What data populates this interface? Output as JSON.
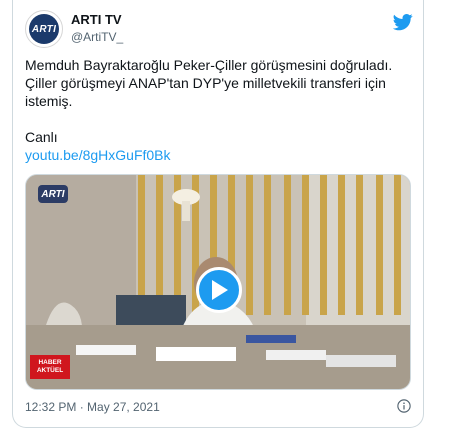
{
  "account": {
    "name": "ARTI TV",
    "handle": "@ArtiTV_",
    "avatar_text": "ARTI"
  },
  "tweet": {
    "text_line1": "Memduh Bayraktaroğlu Peker-Çiller görüşmesini doğruladı. Çiller görüşmeyi ANAP'tan DYP'ye milletvekili transferi için istemiş.",
    "text_canli": "Canlı",
    "link": "youtu.be/8gHxGuFf0Bk"
  },
  "media": {
    "logo_text": "ARTI",
    "badge_line1": "HABER",
    "badge_line2": "AKTÜEL"
  },
  "meta": {
    "timestamp": "12:32 PM · May 27, 2021"
  },
  "colors": {
    "accent": "#1d9bf0",
    "badge": "#d0161e",
    "secondary_text": "#536471"
  },
  "icons": [
    "twitter-bird-icon",
    "play-icon",
    "info-icon"
  ]
}
